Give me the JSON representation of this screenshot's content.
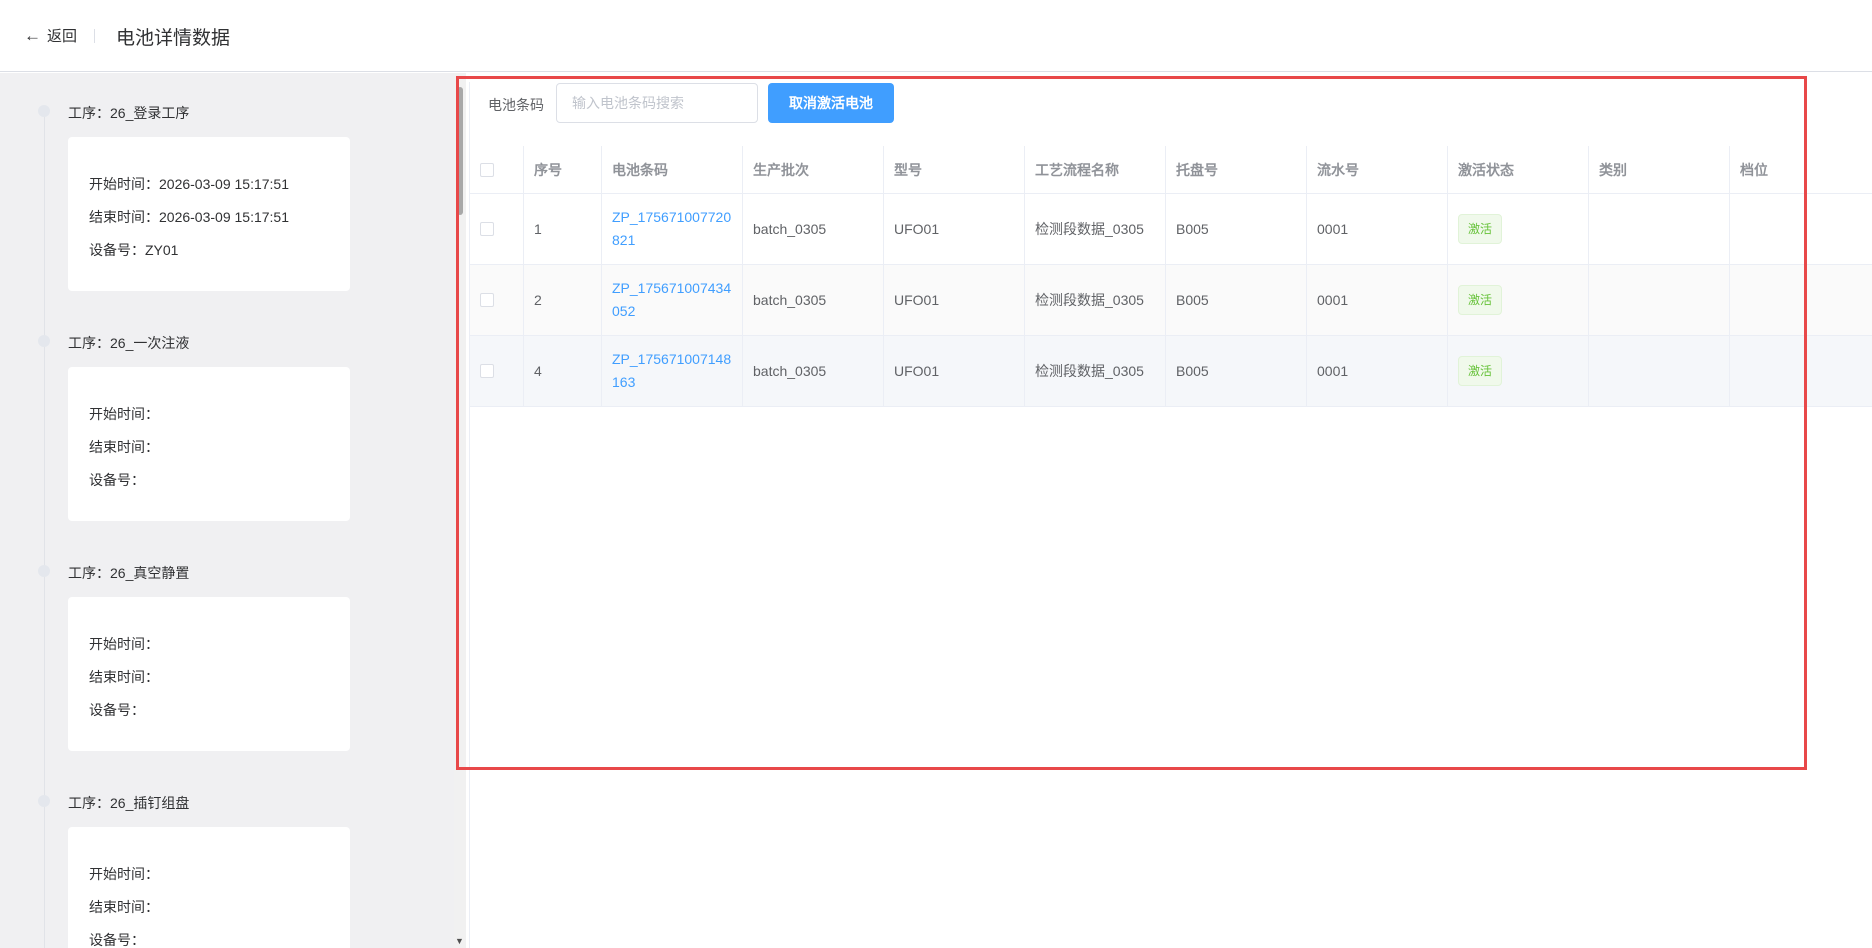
{
  "header": {
    "back_label": "返回",
    "title": "电池详情数据"
  },
  "timeline": {
    "steps": [
      {
        "title": "工序：26_登录工序",
        "start_label": "开始时间：",
        "start_value": "2026-03-09 15:17:51",
        "end_label": "结束时间：",
        "end_value": "2026-03-09 15:17:51",
        "device_label": "设备号：",
        "device_value": "ZY01"
      },
      {
        "title": "工序：26_一次注液",
        "start_label": "开始时间：",
        "start_value": "",
        "end_label": "结束时间：",
        "end_value": "",
        "device_label": "设备号：",
        "device_value": ""
      },
      {
        "title": "工序：26_真空静置",
        "start_label": "开始时间：",
        "start_value": "",
        "end_label": "结束时间：",
        "end_value": "",
        "device_label": "设备号：",
        "device_value": ""
      },
      {
        "title": "工序：26_插钉组盘",
        "start_label": "开始时间：",
        "start_value": "",
        "end_label": "结束时间：",
        "end_value": "",
        "device_label": "设备号：",
        "device_value": ""
      }
    ]
  },
  "search": {
    "label": "电池条码",
    "placeholder": "输入电池条码搜索",
    "value": "",
    "cancel_button": "取消激活电池"
  },
  "table": {
    "columns": [
      "序号",
      "电池条码",
      "生产批次",
      "型号",
      "工艺流程名称",
      "托盘号",
      "流水号",
      "激活状态",
      "类别",
      "档位"
    ],
    "rows": [
      {
        "index": "1",
        "barcode": "ZP_175671007720821",
        "batch": "batch_0305",
        "model": "UFO01",
        "process": "检测段数据_0305",
        "tray": "B005",
        "serial": "0001",
        "status": "激活",
        "category": "",
        "grade": ""
      },
      {
        "index": "2",
        "barcode": "ZP_175671007434052",
        "batch": "batch_0305",
        "model": "UFO01",
        "process": "检测段数据_0305",
        "tray": "B005",
        "serial": "0001",
        "status": "激活",
        "category": "",
        "grade": ""
      },
      {
        "index": "4",
        "barcode": "ZP_175671007148163",
        "batch": "batch_0305",
        "model": "UFO01",
        "process": "检测段数据_0305",
        "tray": "B005",
        "serial": "0001",
        "status": "激活",
        "category": "",
        "grade": ""
      }
    ]
  },
  "colors": {
    "primary": "#409eff",
    "success": "#67c23a",
    "highlight": "#e84849"
  }
}
